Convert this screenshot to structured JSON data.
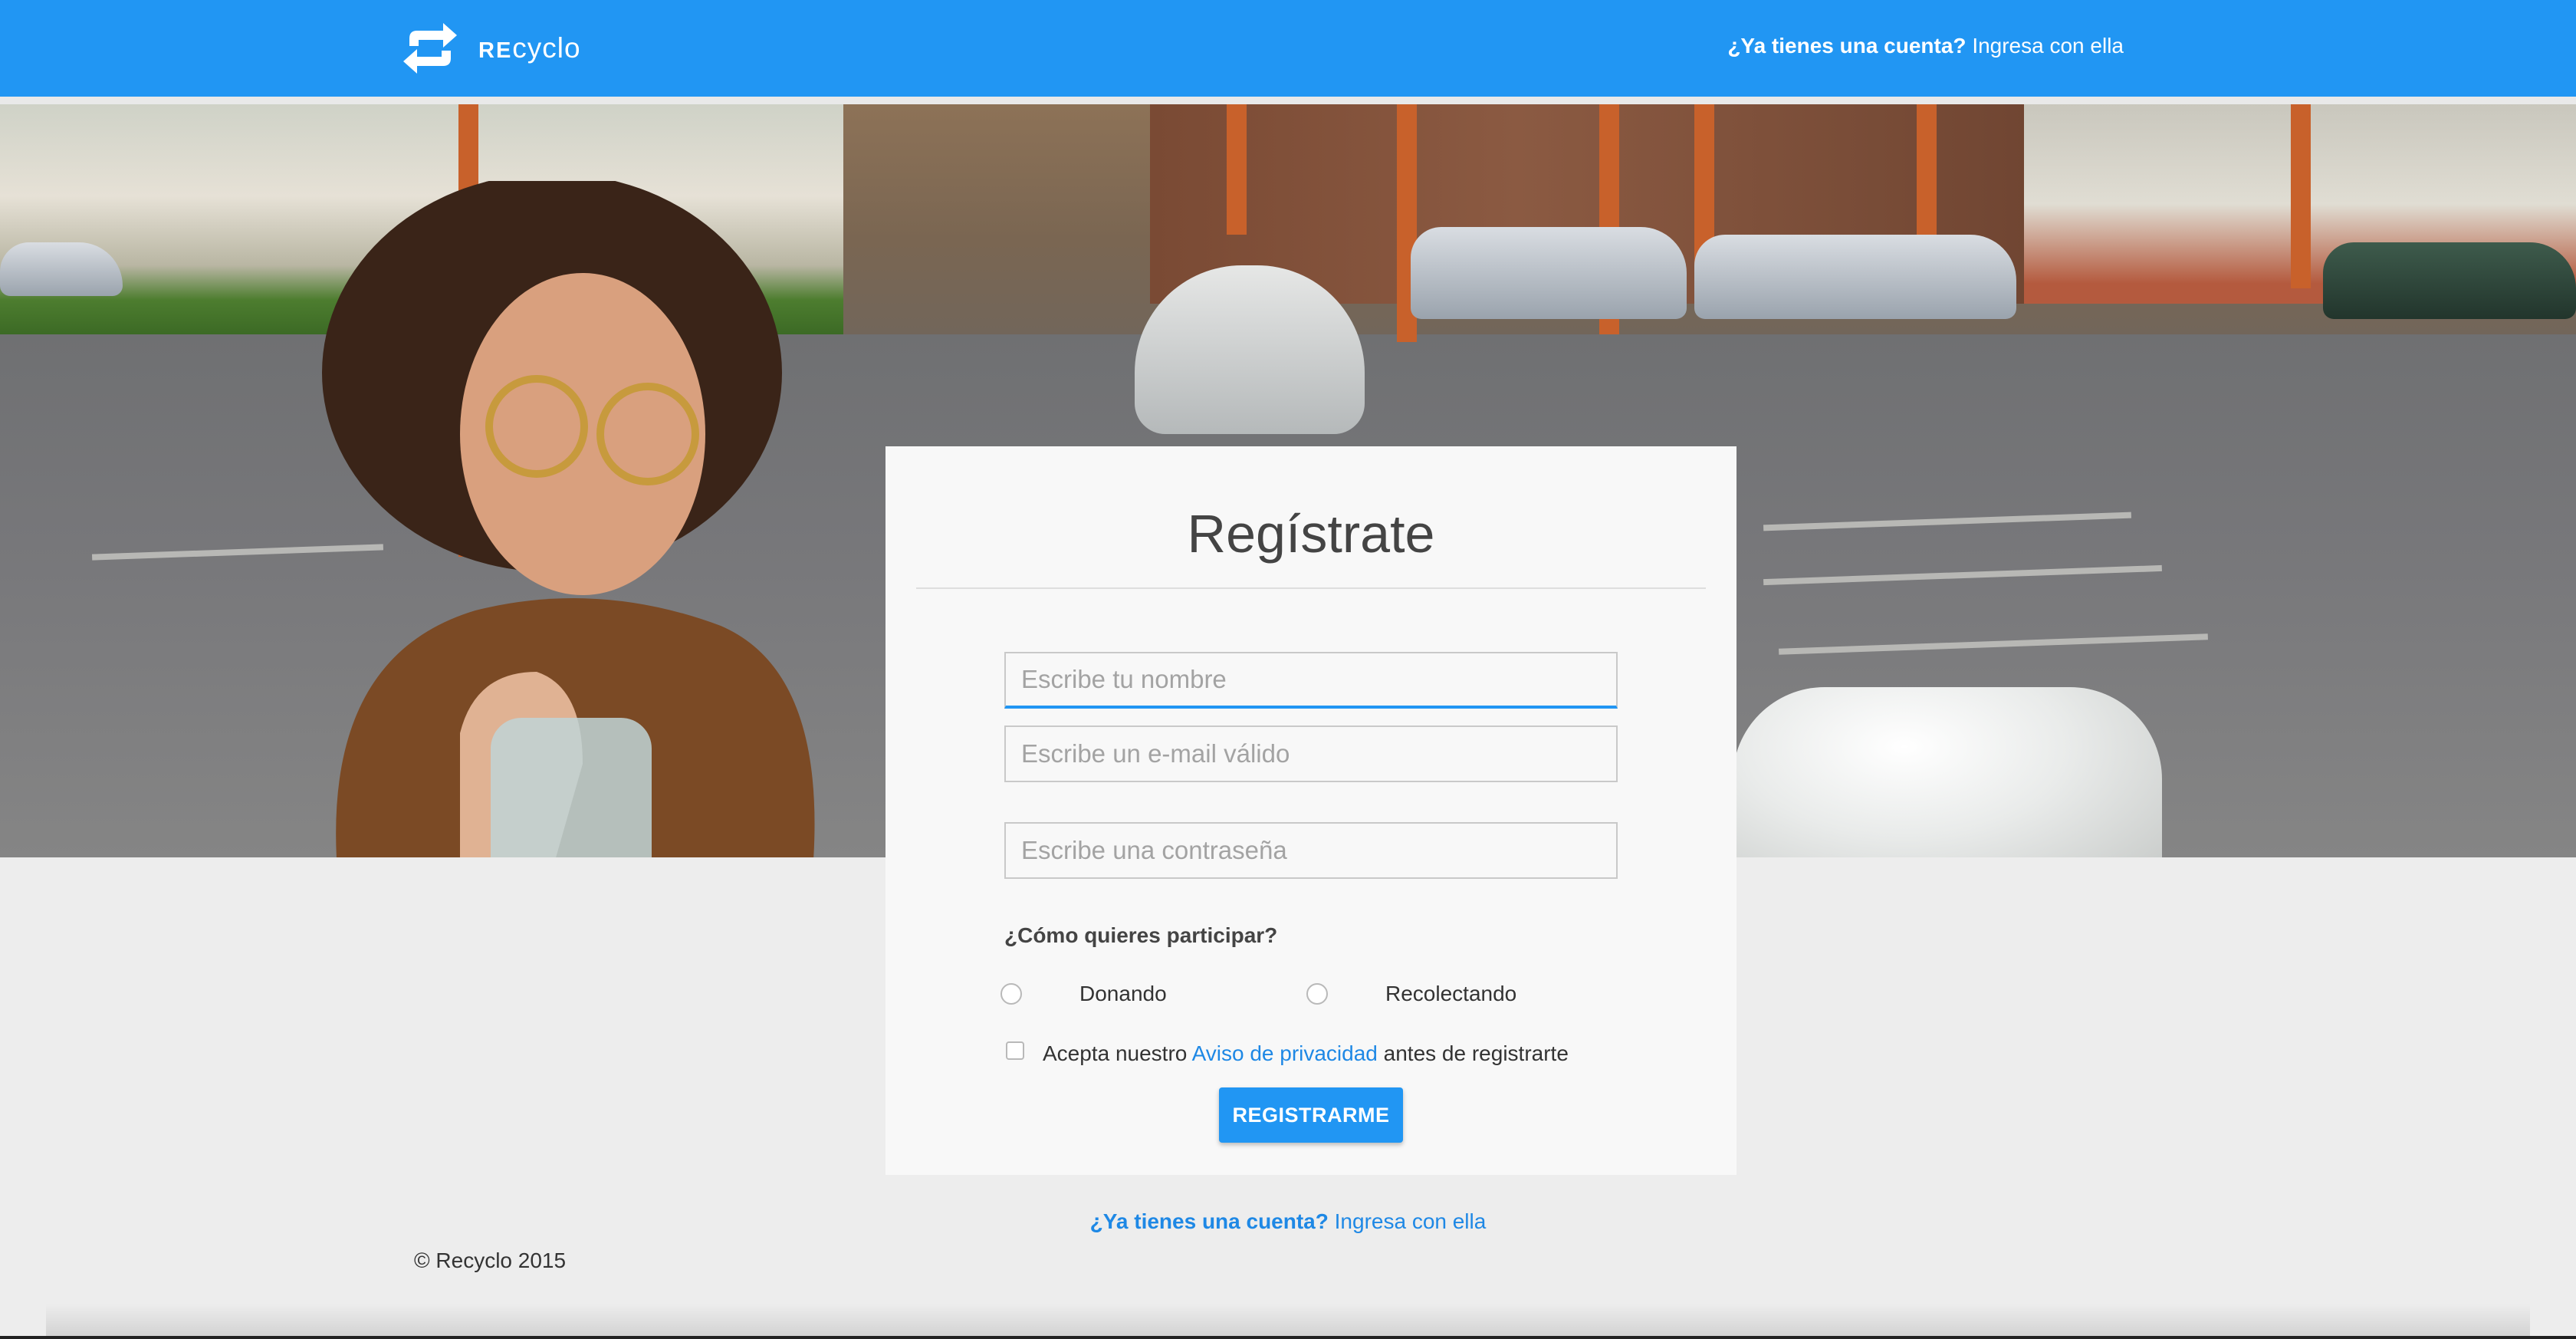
{
  "header": {
    "logo_bold": "RE",
    "logo_light": "cyclo",
    "login_question": "¿Ya tienes una cuenta?",
    "login_link": "Ingresa con ella"
  },
  "form": {
    "title": "Regístrate",
    "name_placeholder": "Escribe tu nombre",
    "email_placeholder": "Escribe un e-mail válido",
    "password_placeholder": "Escribe una contraseña",
    "participation_question": "¿Cómo quieres participar?",
    "options": [
      "Donando",
      "Recolectando"
    ],
    "terms_prefix": "Acepta nuestro ",
    "terms_link": "Aviso de privacidad",
    "terms_suffix": " antes de registrarte",
    "submit_label": "REGISTRARME"
  },
  "footer": {
    "login_question": "¿Ya tienes una cuenta?",
    "login_link": "Ingresa con ella",
    "copyright": "© Recyclo 2015"
  },
  "colors": {
    "primary": "#2196f3",
    "link": "#1e88e5",
    "background": "#ededed",
    "card": "#f8f8f8"
  }
}
